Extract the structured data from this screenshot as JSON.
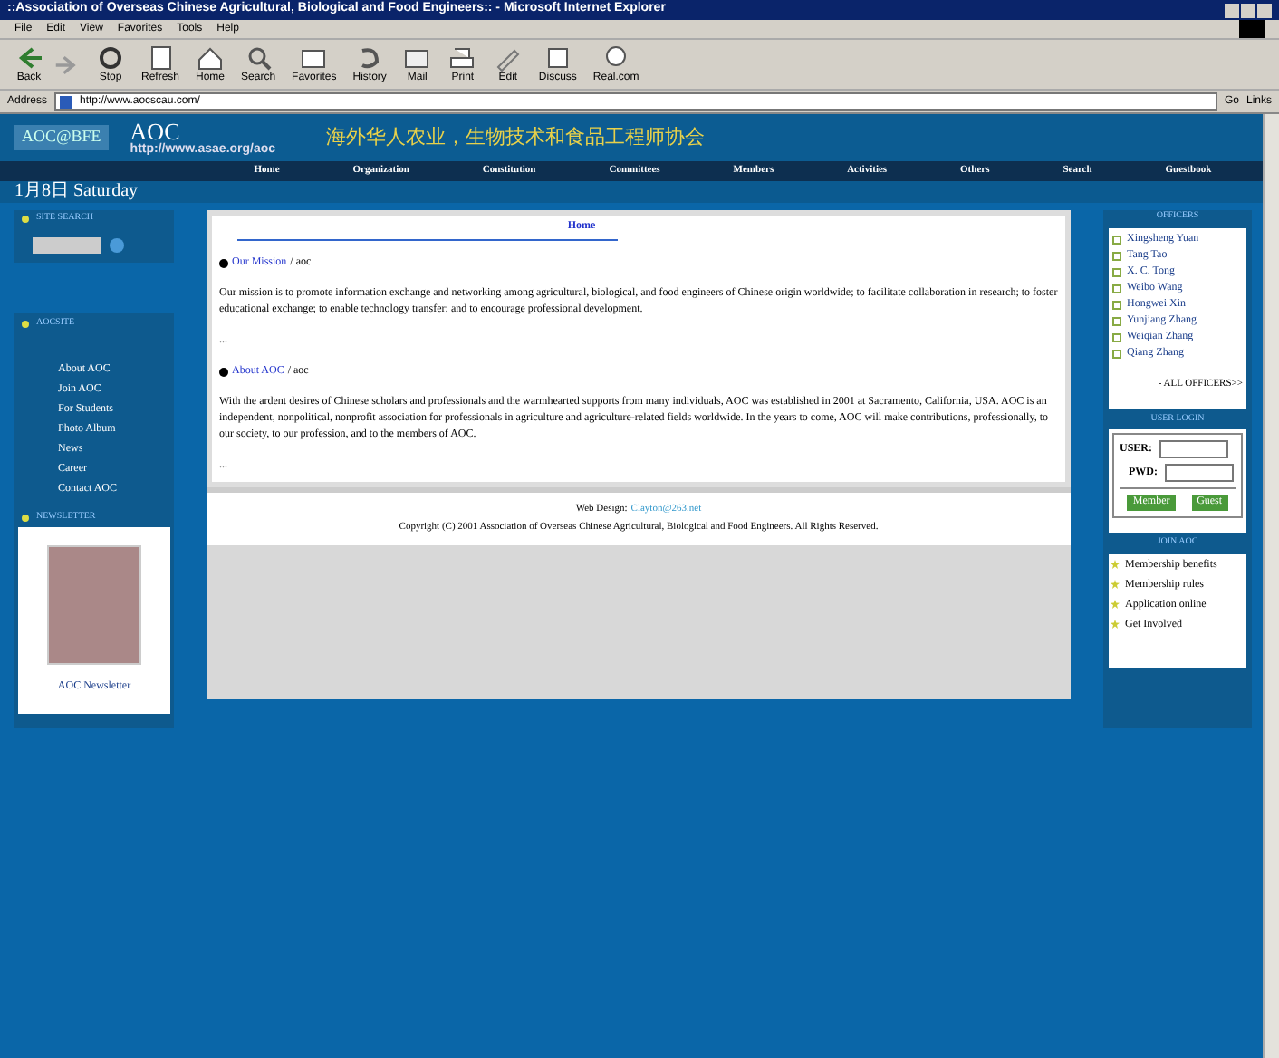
{
  "window": {
    "title": "::Association of Overseas Chinese Agricultural, Biological and Food Engineers:: - Microsoft Internet Explorer"
  },
  "menu": [
    "File",
    "Edit",
    "View",
    "Favorites",
    "Tools",
    "Help"
  ],
  "toolbar": [
    {
      "label": "Back",
      "kind": "back"
    },
    {
      "label": "Stop",
      "kind": "stop"
    },
    {
      "label": "Refresh",
      "kind": "refresh"
    },
    {
      "label": "Home",
      "kind": "home"
    },
    {
      "label": "Search",
      "kind": "search"
    },
    {
      "label": "Favorites",
      "kind": "favorites"
    },
    {
      "label": "History",
      "kind": "history"
    },
    {
      "label": "Mail",
      "kind": "mail"
    },
    {
      "label": "Print",
      "kind": "print"
    },
    {
      "label": "Edit",
      "kind": "edit"
    },
    {
      "label": "Discuss",
      "kind": "discuss"
    },
    {
      "label": "Real.com",
      "kind": "real"
    }
  ],
  "address_bar": {
    "label": "Address",
    "value": "http://www.aocscau.com/",
    "go": "Go",
    "links": "Links"
  },
  "header": {
    "logo": "AOC@BFE",
    "name": "AOC",
    "url": "http://www.asae.org/aoc",
    "title_cn": "海外华人农业，生物技术和食品工程师协会"
  },
  "nav": [
    "Home",
    "Organization",
    "Constitution",
    "Committees",
    "Members",
    "Activities",
    "Others",
    "Search",
    "Guestbook"
  ],
  "date": "1月8日 Saturday",
  "left": {
    "search_title": "SITE SEARCH",
    "site_title": "AOCSITE",
    "links": [
      "About AOC",
      "Join AOC",
      "For Students",
      "Photo Album",
      "News",
      "Career",
      "Contact AOC"
    ],
    "newsletter_title": "NEWSLETTER",
    "newsletter_caption": "AOC Newsletter"
  },
  "main": {
    "heading": "Home",
    "sections": [
      {
        "title": "Our Mission",
        "tag": "/ aoc",
        "text": "Our mission is to promote information exchange and networking among agricultural, biological, and food engineers of Chinese origin worldwide; to facilitate collaboration in research; to foster educational exchange; to enable technology transfer; and to encourage professional development.",
        "more": "..."
      },
      {
        "title": "About AOC",
        "tag": "/ aoc",
        "text": "With the ardent desires of Chinese scholars and professionals and the warmhearted supports from many individuals, AOC was established in 2001 at Sacramento, California, USA. AOC is an independent, nonpolitical, nonprofit association for professionals in agriculture and agriculture-related fields worldwide. In the years to come, AOC will make contributions, professionally, to our society, to our profession, and to the members of AOC.",
        "more": "..."
      }
    ]
  },
  "footer": {
    "design_label": "Web Design:",
    "design_link": "Clayton@263.net",
    "copyright": "Copyright (C) 2001 Association of Overseas Chinese Agricultural, Biological and Food Engineers. All Rights Reserved."
  },
  "right": {
    "officers_title": "OFFICERS",
    "officers": [
      "Xingsheng Yuan",
      "Tang Tao",
      "X. C. Tong",
      "Weibo Wang",
      "Hongwei Xin",
      "Yunjiang Zhang",
      "Weiqian Zhang",
      "Qiang Zhang"
    ],
    "all_officers": "- ALL OFFICERS>>",
    "login_title": "USER LOGIN",
    "user_label": "USER:",
    "pwd_label": "PWD:",
    "buttons": [
      "Member",
      "Guest"
    ],
    "join_title": "JOIN AOC",
    "join_items": [
      "Membership benefits",
      "Membership rules",
      "Application online",
      "Get Involved"
    ]
  }
}
